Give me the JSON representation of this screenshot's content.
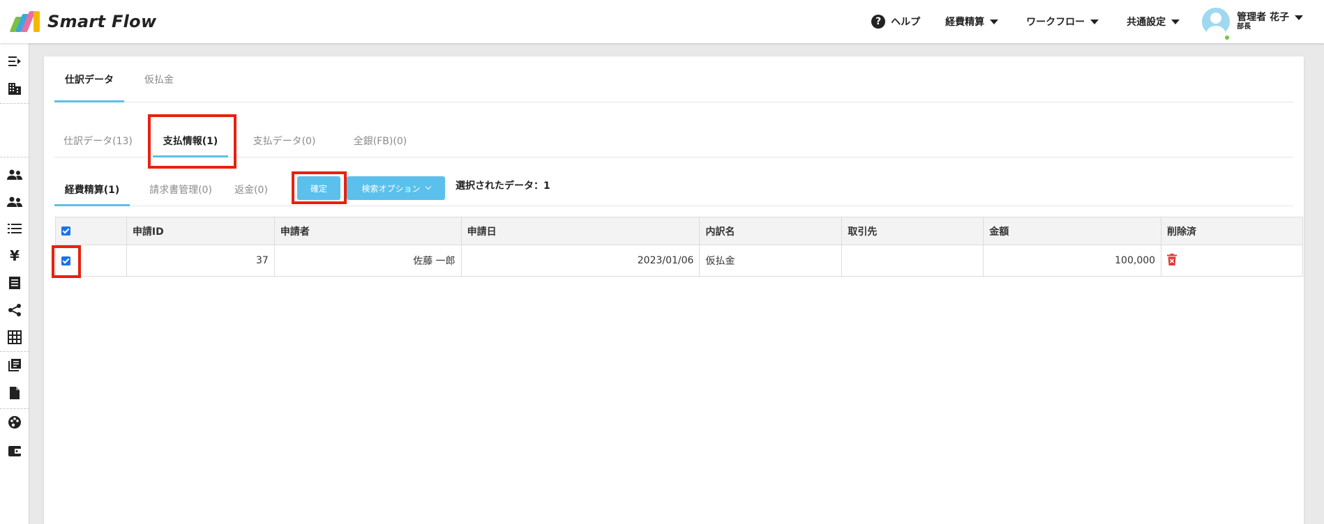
{
  "header": {
    "logo_text": "Smart Flow",
    "logo_colors": [
      "#7bc043",
      "#3aa7e0",
      "#e86fa3",
      "#f5b800"
    ],
    "help_label": "ヘルプ",
    "nav": [
      {
        "label": "経費精算"
      },
      {
        "label": "ワークフロー"
      },
      {
        "label": "共通設定"
      }
    ],
    "user": {
      "name": "管理者 花子",
      "role": "部長",
      "status_color": "#6dc93e"
    }
  },
  "sidebar": {
    "icons": [
      "expand-menu-icon",
      "building-icon",
      "users-icon",
      "users-alt-icon",
      "list-icon",
      "yen-icon",
      "receipt-icon",
      "share-icon",
      "grid-icon",
      "library-icon",
      "document-icon",
      "palette-icon",
      "wallet-icon"
    ]
  },
  "tabs_level1": [
    {
      "label": "仕訳データ",
      "active": true
    },
    {
      "label": "仮払金",
      "active": false
    }
  ],
  "tabs_level2": [
    {
      "label": "仕訳データ(13)",
      "active": false
    },
    {
      "label": "支払情報(1)",
      "active": true
    },
    {
      "label": "支払データ(0)",
      "active": false
    },
    {
      "label": "全銀(FB)(0)",
      "active": false
    }
  ],
  "tabs_level3": [
    {
      "label": "経費精算(1)",
      "active": true
    },
    {
      "label": "請求書管理(0)",
      "active": false
    },
    {
      "label": "返金(0)",
      "active": false
    }
  ],
  "actions": {
    "confirm_label": "確定",
    "search_option_label": "検索オプション",
    "selected_text": "選択されたデータ：1"
  },
  "table": {
    "headers": [
      "",
      "申請ID",
      "申請者",
      "申請日",
      "内訳名",
      "取引先",
      "金額",
      "削除済"
    ],
    "rows": [
      {
        "checked": true,
        "id": "37",
        "applicant": "佐藤 一郎",
        "date": "2023/01/06",
        "item": "仮払金",
        "vendor": "",
        "amount": "100,000",
        "deleted_icon": "trash-icon"
      }
    ]
  },
  "colors": {
    "accent": "#5bc0eb",
    "highlight": "#e8210f",
    "checkbox": "#1a73e8",
    "delete": "#e53935"
  }
}
